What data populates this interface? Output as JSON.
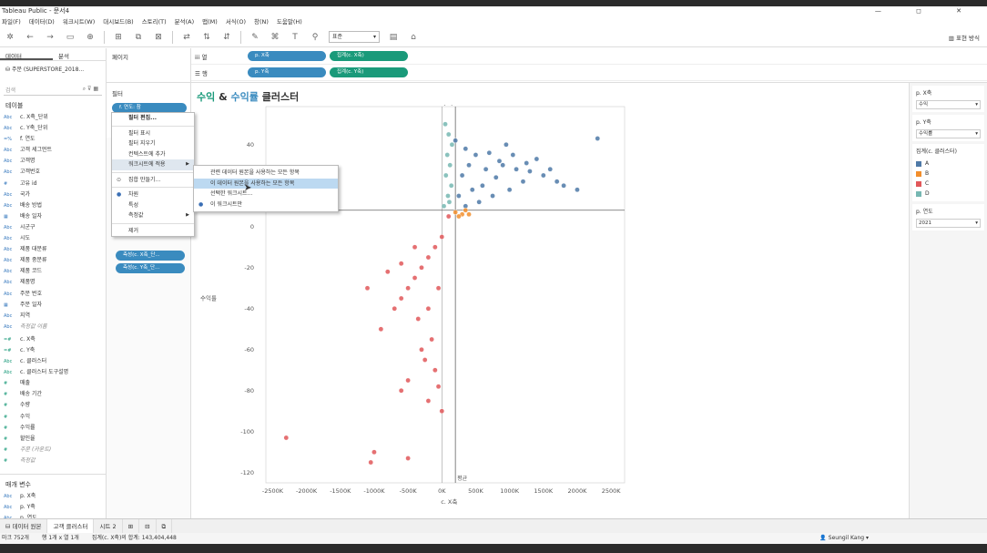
{
  "window": {
    "title": "Tableau Public - 문서4"
  },
  "menubar": [
    "파일(F)",
    "데이터(D)",
    "워크시트(W)",
    "대시보드(B)",
    "스토리(T)",
    "분석(A)",
    "맵(M)",
    "서식(O)",
    "창(N)",
    "도움말(H)"
  ],
  "toolbar": {
    "fit": "표준",
    "showme": "표현 방식"
  },
  "datapane": {
    "tab_data": "데이터",
    "tab_analysis": "분석",
    "source": "주문 (SUPERSTORE_2018...",
    "search_placeholder": "검색",
    "tables_header": "테이블",
    "fields": [
      {
        "type": "Abc",
        "name": "c. X축_단위"
      },
      {
        "type": "Abc",
        "name": "c. Y축_단위"
      },
      {
        "type": "=%",
        "name": "f. 연도"
      },
      {
        "type": "Abc",
        "name": "고객 세그먼트"
      },
      {
        "type": "Abc",
        "name": "고객명"
      },
      {
        "type": "Abc",
        "name": "고객번호"
      },
      {
        "type": "#",
        "name": "고유 id"
      },
      {
        "type": "Abc",
        "name": "국가"
      },
      {
        "type": "Abc",
        "name": "배송 방법"
      },
      {
        "type": "▦",
        "name": "배송 일자"
      },
      {
        "type": "Abc",
        "name": "시군구"
      },
      {
        "type": "Abc",
        "name": "시도"
      },
      {
        "type": "Abc",
        "name": "제품 대분류"
      },
      {
        "type": "Abc",
        "name": "제품 중분류"
      },
      {
        "type": "Abc",
        "name": "제품 코드"
      },
      {
        "type": "Abc",
        "name": "제품명"
      },
      {
        "type": "Abc",
        "name": "주문 번호"
      },
      {
        "type": "▦",
        "name": "주문 일자"
      },
      {
        "type": "Abc",
        "name": "지역"
      },
      {
        "type": "Abc",
        "name": "측정값 이름",
        "italic": true
      }
    ],
    "measures": [
      {
        "type": "=#",
        "name": "c. X축"
      },
      {
        "type": "=#",
        "name": "c. Y축"
      },
      {
        "type": "Abc",
        "name": "c. 클러스터"
      },
      {
        "type": "Abc",
        "name": "c. 클러스터 도구설명"
      },
      {
        "type": "#",
        "name": "매출"
      },
      {
        "type": "#",
        "name": "배송 기간"
      },
      {
        "type": "#",
        "name": "수량"
      },
      {
        "type": "#",
        "name": "수익"
      },
      {
        "type": "#",
        "name": "수익률"
      },
      {
        "type": "#",
        "name": "할인율"
      },
      {
        "type": "#",
        "name": "주문 (카운트)",
        "italic": true
      },
      {
        "type": "#",
        "name": "측정값",
        "italic": true
      }
    ],
    "params_header": "매개 변수",
    "params": [
      {
        "type": "Abc",
        "name": "p. X축"
      },
      {
        "type": "Abc",
        "name": "p. Y축"
      },
      {
        "type": "Abc",
        "name": "p. 연도"
      }
    ]
  },
  "pages": {
    "label": "페이지"
  },
  "filters": {
    "label": "필터",
    "pill": "f. 연도: 참"
  },
  "marks_pills": [
    "측성(c. X축_단...",
    "측성(c. Y축_단..."
  ],
  "shelves": {
    "columns_label": "열",
    "rows_label": "행",
    "col_pills": [
      "p. X축",
      "집계(c. X축)"
    ],
    "row_pills": [
      "p. Y축",
      "집계(c. Y축)"
    ]
  },
  "view": {
    "title_a": "수익",
    "title_amp": " & ",
    "title_b": "수익률",
    "title_c": " 클러스터"
  },
  "context_menu": {
    "items": [
      "필터 편집...",
      "필터 표시",
      "필터 지우기",
      "컨텍스트에 추가",
      "워크시트에 적용",
      "집합 만들기...",
      "차원",
      "특성",
      "측정값",
      "제거"
    ]
  },
  "submenu": {
    "items": [
      "관련 데이터 원본을 사용하는 모든 항목",
      "이 데이터 원본을 사용하는 모든 항목",
      "선택한 워크시트...",
      "이 워크시트만"
    ]
  },
  "legends": {
    "px_title": "p. X축",
    "px_value": "수익",
    "py_title": "p. Y축",
    "py_value": "수익률",
    "cluster_title": "집계(c. 클러스터)",
    "clusters": [
      {
        "name": "A",
        "color": "#4e79a7"
      },
      {
        "name": "B",
        "color": "#f28e2b"
      },
      {
        "name": "C",
        "color": "#e15759"
      },
      {
        "name": "D",
        "color": "#76b7b2"
      }
    ],
    "year_title": "p. 연도",
    "year_value": "2021"
  },
  "sheettabs": [
    "데이터 원본",
    "고객 클러스터",
    "시트 2"
  ],
  "status": {
    "marks": "마크 752개",
    "rowscols": "행 1개 x 열 1개",
    "sum": "집계(c. X축)의 합계: 143,404,448",
    "user": "Seungil Kang"
  },
  "chart_data": {
    "type": "scatter",
    "title": "수익 & 수익률 클러스터",
    "xlabel": "c. X축",
    "ylabel": "수익률",
    "top_axis_label": "수익",
    "xlim": [
      -2600000,
      2700000
    ],
    "ylim": [
      -125,
      55
    ],
    "xticks": [
      "-2500K",
      "-2000K",
      "-1500K",
      "-1000K",
      "-500K",
      "0K",
      "500K",
      "1000K",
      "1500K",
      "2000K",
      "2500K"
    ],
    "xtick_values": [
      -2500000,
      -2000000,
      -1500000,
      -1000000,
      -500000,
      0,
      500000,
      1000000,
      1500000,
      2000000,
      2500000
    ],
    "yticks": [
      40,
      20,
      0,
      -20,
      -40,
      -60,
      -80,
      -100,
      -120
    ],
    "ref_lines": {
      "x": 200000,
      "y": 8,
      "label": "평균"
    },
    "series": [
      {
        "name": "A",
        "color": "#4e79a7",
        "points": [
          [
            200000,
            42
          ],
          [
            350000,
            38
          ],
          [
            500000,
            35
          ],
          [
            700000,
            36
          ],
          [
            900000,
            30
          ],
          [
            1100000,
            28
          ],
          [
            1300000,
            27
          ],
          [
            1500000,
            25
          ],
          [
            1700000,
            22
          ],
          [
            2300000,
            43
          ],
          [
            600000,
            20
          ],
          [
            800000,
            24
          ],
          [
            400000,
            30
          ],
          [
            300000,
            25
          ],
          [
            1000000,
            18
          ],
          [
            1200000,
            22
          ],
          [
            250000,
            15
          ],
          [
            450000,
            18
          ],
          [
            650000,
            28
          ],
          [
            850000,
            32
          ],
          [
            950000,
            40
          ],
          [
            1400000,
            33
          ],
          [
            1600000,
            28
          ],
          [
            1800000,
            20
          ],
          [
            2000000,
            18
          ],
          [
            550000,
            12
          ],
          [
            350000,
            10
          ],
          [
            750000,
            15
          ],
          [
            1050000,
            35
          ],
          [
            1250000,
            31
          ]
        ]
      },
      {
        "name": "B",
        "color": "#f28e2b",
        "points": [
          [
            200000,
            7
          ],
          [
            300000,
            6
          ],
          [
            400000,
            6
          ],
          [
            250000,
            5
          ],
          [
            350000,
            8
          ]
        ]
      },
      {
        "name": "C",
        "color": "#e15759",
        "points": [
          [
            100000,
            5
          ],
          [
            0,
            -5
          ],
          [
            -100000,
            -10
          ],
          [
            -200000,
            -15
          ],
          [
            -300000,
            -20
          ],
          [
            -400000,
            -25
          ],
          [
            -500000,
            -30
          ],
          [
            -600000,
            -35
          ],
          [
            -700000,
            -40
          ],
          [
            -900000,
            -50
          ],
          [
            -300000,
            -60
          ],
          [
            -100000,
            -70
          ],
          [
            -500000,
            -75
          ],
          [
            -2300000,
            -103
          ],
          [
            -1000000,
            -110
          ],
          [
            -1050000,
            -115
          ],
          [
            -500000,
            -113
          ],
          [
            -200000,
            -85
          ],
          [
            -50000,
            -78
          ],
          [
            -1100000,
            -30
          ],
          [
            -200000,
            -40
          ],
          [
            -400000,
            -10
          ],
          [
            -600000,
            -18
          ],
          [
            -150000,
            -55
          ],
          [
            -50000,
            -30
          ],
          [
            -350000,
            -45
          ],
          [
            -250000,
            -65
          ],
          [
            -800000,
            -22
          ],
          [
            0,
            -90
          ],
          [
            -600000,
            -80
          ]
        ]
      },
      {
        "name": "D",
        "color": "#76b7b2",
        "points": [
          [
            50000,
            50
          ],
          [
            100000,
            45
          ],
          [
            150000,
            40
          ],
          [
            80000,
            35
          ],
          [
            120000,
            30
          ],
          [
            60000,
            25
          ],
          [
            140000,
            20
          ],
          [
            90000,
            15
          ],
          [
            30000,
            10
          ],
          [
            110000,
            12
          ]
        ]
      }
    ]
  }
}
